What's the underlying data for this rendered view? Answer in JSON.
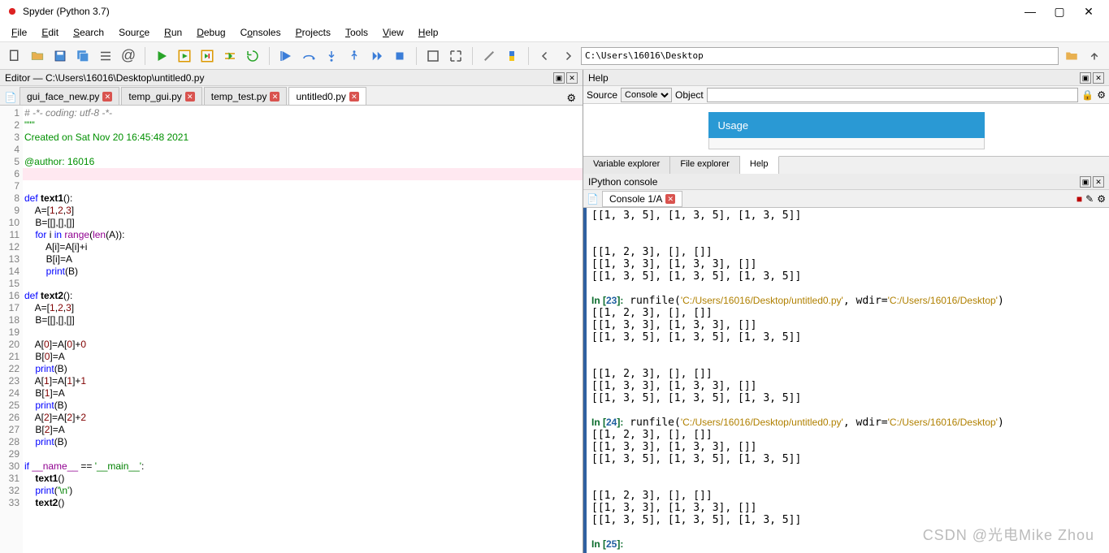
{
  "window": {
    "title": "Spyder (Python 3.7)"
  },
  "menu": {
    "file": "File",
    "edit": "Edit",
    "search": "Search",
    "source": "Source",
    "run": "Run",
    "debug": "Debug",
    "consoles": "Consoles",
    "projects": "Projects",
    "tools": "Tools",
    "view": "View",
    "help": "Help"
  },
  "path_bar": {
    "value": "C:\\Users\\16016\\Desktop"
  },
  "editor": {
    "header": "Editor — C:\\Users\\16016\\Desktop\\untitled0.py",
    "tabs": [
      {
        "label": "gui_face_new.py",
        "active": false,
        "close": true
      },
      {
        "label": "temp_gui.py",
        "active": false,
        "close": true
      },
      {
        "label": "temp_test.py",
        "active": false,
        "close": true
      },
      {
        "label": "untitled0.py",
        "active": true,
        "close": true
      }
    ],
    "lines": [
      "# -*- coding: utf-8 -*-",
      "\"\"\"",
      "Created on Sat Nov 20 16:45:48 2021",
      "",
      "@author: 16016",
      "\"\"\"",
      "",
      "def text1():",
      "    A=[1,2,3]",
      "    B=[[],[],[]]",
      "    for i in range(len(A)):",
      "        A[i]=A[i]+i",
      "        B[i]=A",
      "        print(B)",
      "",
      "def text2():",
      "    A=[1,2,3]",
      "    B=[[],[],[]]",
      "",
      "    A[0]=A[0]+0",
      "    B[0]=A",
      "    print(B)",
      "    A[1]=A[1]+1",
      "    B[1]=A",
      "    print(B)",
      "    A[2]=A[2]+2",
      "    B[2]=A",
      "    print(B)",
      "",
      "if __name__ == '__main__':",
      "    text1()",
      "    print('\\n')",
      "    text2()"
    ]
  },
  "help": {
    "header": "Help",
    "source_label": "Source",
    "source_value": "Console",
    "object_label": "Object",
    "object_value": "",
    "usage": "Usage",
    "tabs": [
      {
        "label": "Variable explorer"
      },
      {
        "label": "File explorer"
      },
      {
        "label": "Help",
        "active": true
      }
    ]
  },
  "ipython": {
    "header": "IPython console",
    "tab_label": "Console 1/A",
    "output": [
      {
        "t": "plain",
        "text": "[[1, 3, 5], [1, 3, 5], [1, 3, 5]]"
      },
      {
        "t": "blank"
      },
      {
        "t": "blank"
      },
      {
        "t": "plain",
        "text": "[[1, 2, 3], [], []]"
      },
      {
        "t": "plain",
        "text": "[[1, 3, 3], [1, 3, 3], []]"
      },
      {
        "t": "plain",
        "text": "[[1, 3, 5], [1, 3, 5], [1, 3, 5]]"
      },
      {
        "t": "blank"
      },
      {
        "t": "in",
        "n": "23",
        "cmd": "runfile(",
        "path": "'C:/Users/16016/Desktop/untitled0.py'",
        "rest": ", wdir=",
        "path2": "'C:/Users/16016/Desktop'",
        "close": ")"
      },
      {
        "t": "plain",
        "text": "[[1, 2, 3], [], []]"
      },
      {
        "t": "plain",
        "text": "[[1, 3, 3], [1, 3, 3], []]"
      },
      {
        "t": "plain",
        "text": "[[1, 3, 5], [1, 3, 5], [1, 3, 5]]"
      },
      {
        "t": "blank"
      },
      {
        "t": "blank"
      },
      {
        "t": "plain",
        "text": "[[1, 2, 3], [], []]"
      },
      {
        "t": "plain",
        "text": "[[1, 3, 3], [1, 3, 3], []]"
      },
      {
        "t": "plain",
        "text": "[[1, 3, 5], [1, 3, 5], [1, 3, 5]]"
      },
      {
        "t": "blank"
      },
      {
        "t": "in",
        "n": "24",
        "cmd": "runfile(",
        "path": "'C:/Users/16016/Desktop/untitled0.py'",
        "rest": ", wdir=",
        "path2": "'C:/Users/16016/Desktop'",
        "close": ")"
      },
      {
        "t": "plain",
        "text": "[[1, 2, 3], [], []]"
      },
      {
        "t": "plain",
        "text": "[[1, 3, 3], [1, 3, 3], []]"
      },
      {
        "t": "plain",
        "text": "[[1, 3, 5], [1, 3, 5], [1, 3, 5]]"
      },
      {
        "t": "blank"
      },
      {
        "t": "blank"
      },
      {
        "t": "plain",
        "text": "[[1, 2, 3], [], []]"
      },
      {
        "t": "plain",
        "text": "[[1, 3, 3], [1, 3, 3], []]"
      },
      {
        "t": "plain",
        "text": "[[1, 3, 5], [1, 3, 5], [1, 3, 5]]"
      },
      {
        "t": "blank"
      },
      {
        "t": "in-open",
        "n": "25"
      }
    ]
  },
  "watermark": "CSDN @光电Mike Zhou"
}
